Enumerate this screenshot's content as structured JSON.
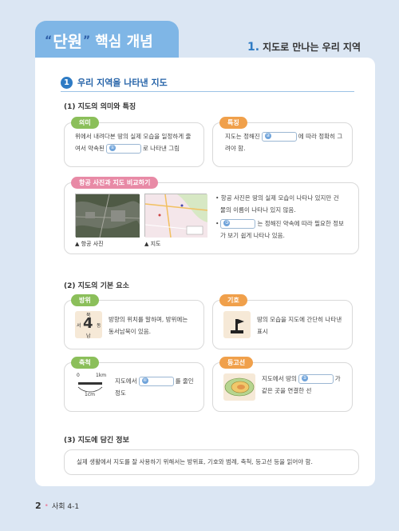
{
  "header": {
    "quote_open": "“",
    "unit": "단원",
    "quote_close": "”",
    "concept": "핵심 개념"
  },
  "chapter": {
    "num": "1.",
    "title": "지도로 만나는 우리 지역"
  },
  "section1": {
    "num": "1",
    "title": "우리 지역을 나타낸 지도"
  },
  "sub1": "(1) 지도의 의미와 특징",
  "meaning": {
    "tag": "의미",
    "text_a": "위에서 내려다본 땅의 실제 모습을 일정하게 줄",
    "text_b": "여서 약속된",
    "blank": "①",
    "text_c": "로 나타낸 그림"
  },
  "feature": {
    "tag": "특징",
    "text_a": "지도는 정해진",
    "blank": "②",
    "text_b": "에 따라 정확히 그",
    "text_c": "려야 함."
  },
  "compare": {
    "tag": "항공 사진과 지도 비교하기",
    "cap_photo": "▲ 항공 사진",
    "cap_map": "▲ 지도",
    "b1_a": "• 항공 사진은 땅의 실제 모습이 나타나 있지만 건",
    "b1_b": "물의 이름이 나타나 있지 않음.",
    "b2_pre": "•",
    "blank": "③",
    "b2_a": "는 정해진 약속에 따라 필요한 정보",
    "b2_b": "가 보기 쉽게 나타나 있음."
  },
  "sub2": "(2) 지도의 기본 요소",
  "direction": {
    "tag": "방위",
    "n": "북",
    "s": "남",
    "w": "서",
    "e": "동",
    "four": "4",
    "text_a": "방향의 위치를 말하며, 방위에는",
    "text_b": "동서남북이 있음."
  },
  "symbol": {
    "tag": "기호",
    "text_a": "땅의 모습을 지도에 간단히 나타낸",
    "text_b": "표시"
  },
  "scale": {
    "tag": "축척",
    "zero": "0",
    "km1": "1km",
    "cm1": "1cm",
    "text_a": "지도에서",
    "blank": "④",
    "text_b": "를 줄인",
    "text_c": "정도"
  },
  "contour": {
    "tag": "등고선",
    "text_a": "지도에서 땅의",
    "blank": "⑤",
    "text_b": "가",
    "text_c": "같은 곳을 연결한 선"
  },
  "sub3": "(3) 지도에 담긴 정보",
  "info": {
    "text": "실제 생활에서 지도를 잘 사용하기 위해서는 방위표, 기호와 범례, 축척, 등고선 등을 읽어야 함."
  },
  "footer": {
    "page": "2",
    "dot": "•",
    "book": "사회 4-1"
  }
}
